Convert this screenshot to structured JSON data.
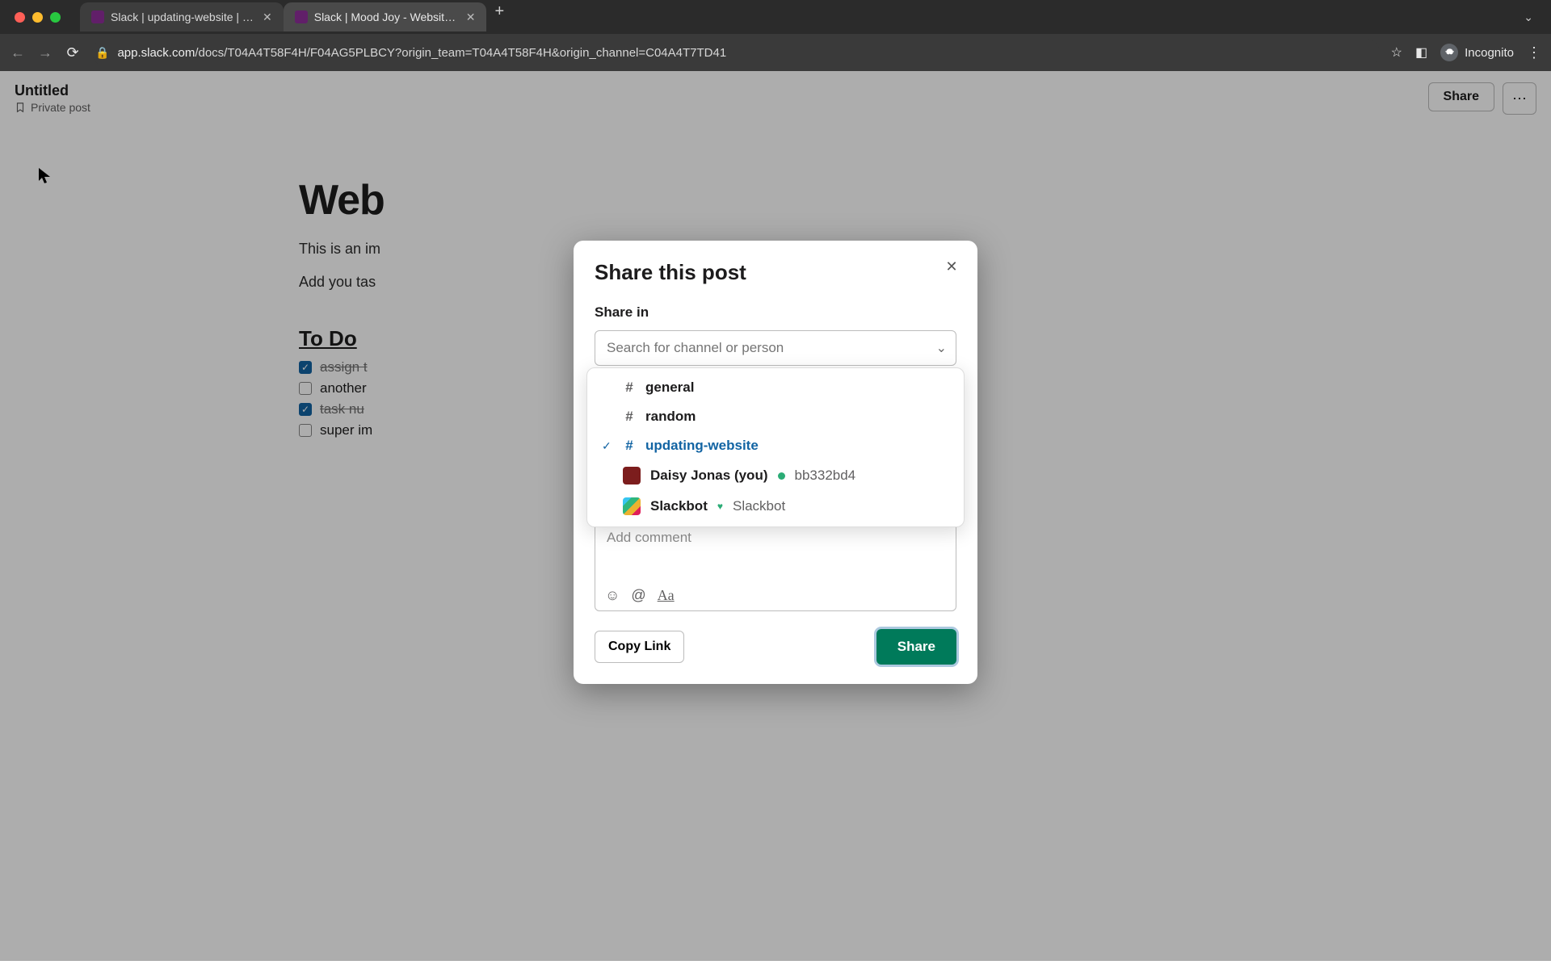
{
  "browser": {
    "tabs": [
      {
        "title": "Slack | updating-website | Moo",
        "active": false
      },
      {
        "title": "Slack | Mood Joy - Website Re",
        "active": true
      }
    ],
    "url_host": "app.slack.com",
    "url_path": "/docs/T04A4T58F4H/F04AG5PLBCY?origin_team=T04A4T58F4H&origin_channel=C04A4T7TD41",
    "incognito_label": "Incognito"
  },
  "doc_header": {
    "title": "Untitled",
    "subtitle": "Private post",
    "share_label": "Share"
  },
  "doc": {
    "heading_visible_prefix": "Web",
    "para1": "This is an im",
    "para2": "Add you tas",
    "todo_heading": "To Do ",
    "tasks": [
      {
        "text": "assign t",
        "checked": true
      },
      {
        "text": "another",
        "checked": false
      },
      {
        "text": "task nu",
        "checked": true
      },
      {
        "text": "super im",
        "checked": false
      }
    ]
  },
  "modal": {
    "title": "Share this post",
    "share_in_label": "Share in",
    "search_placeholder": "Search for channel or person",
    "options": {
      "general": "general",
      "random": "random",
      "updating": "updating-website",
      "daisy_name": "Daisy Jonas (you)",
      "daisy_id": "bb332bd4",
      "slackbot_name": "Slackbot",
      "slackbot_sub": "Slackbot"
    },
    "comment_placeholder": "Add comment",
    "copy_link_label": "Copy Link",
    "share_label": "Share"
  }
}
